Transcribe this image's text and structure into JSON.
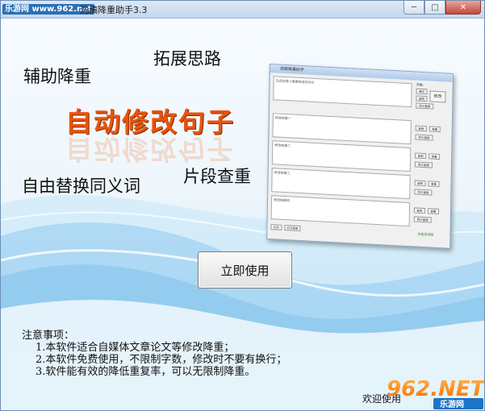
{
  "window": {
    "title": "洗稿降重助手3.3",
    "watermark": "乐游网 www.962.net",
    "controls": {
      "minimize": "─",
      "maximize": "□",
      "close": "✕"
    }
  },
  "features": {
    "assist": "辅助降重",
    "expand": "拓展思路",
    "headline": "自动修改句子",
    "synonyms": "自由替换同义词",
    "fragment": "片段查重"
  },
  "preview": {
    "title": "洗稿降重助手",
    "side_label": "字数:",
    "input_placeholder": "在此处输入需要修改的句子",
    "boxes": [
      "修改结果一",
      "修改结果二",
      "修改结果三",
      "修改结果四"
    ],
    "buttons": {
      "modify": "修改",
      "copy": "复制",
      "view": "查看",
      "replace": "同义替换",
      "clear": "清空",
      "open": "打开",
      "open_file": "打开目录"
    },
    "status": "功能测试版"
  },
  "start_button": "立即使用",
  "notes": {
    "title": "注意事项：",
    "items": [
      "1.本软件适合自媒体文章论文等修改降重；",
      "2.本软件免费使用，不限制字数，修改时不要有换行；",
      "3.软件能有效的降低重复率，可以无限制降重。"
    ]
  },
  "welcome": "欢迎使用",
  "logo": {
    "text": "962.NET",
    "sub": "乐游网"
  },
  "colors": {
    "headline": "#e8540d",
    "accent_blue": "#2a6fb6",
    "wave": "#8fcaf0"
  }
}
